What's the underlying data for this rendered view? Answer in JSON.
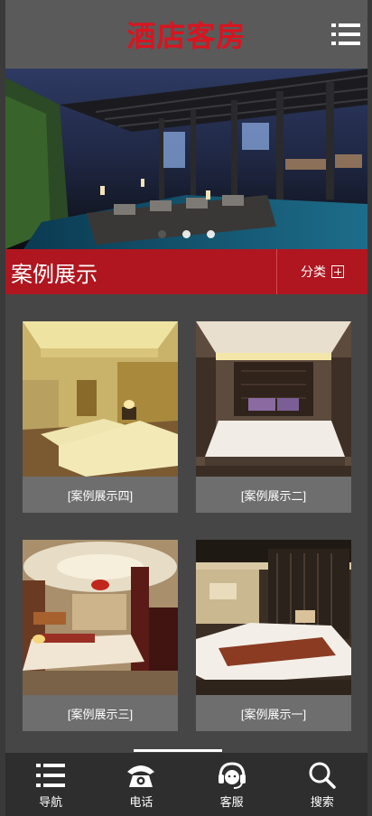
{
  "header": {
    "logo_text": "酒店客房",
    "menu_icon": "menu-list-icon"
  },
  "banner": {
    "slides": 3,
    "active_slide": 1
  },
  "section": {
    "title": "案例展示",
    "category_label": "分类",
    "category_icon": "plus-box-icon"
  },
  "cases": [
    {
      "caption": "[案例展示四]"
    },
    {
      "caption": "[案例展示二]"
    },
    {
      "caption": "[案例展示三]"
    },
    {
      "caption": "[案例展示一]"
    }
  ],
  "bottom_nav": [
    {
      "label": "导航",
      "icon": "list-icon"
    },
    {
      "label": "电话",
      "icon": "phone-icon"
    },
    {
      "label": "客服",
      "icon": "headset-icon"
    },
    {
      "label": "搜索",
      "icon": "search-icon"
    }
  ],
  "colors": {
    "brand_red": "#b0161f",
    "logo_red": "#d9141f",
    "header_gray": "#5a5a5a"
  }
}
